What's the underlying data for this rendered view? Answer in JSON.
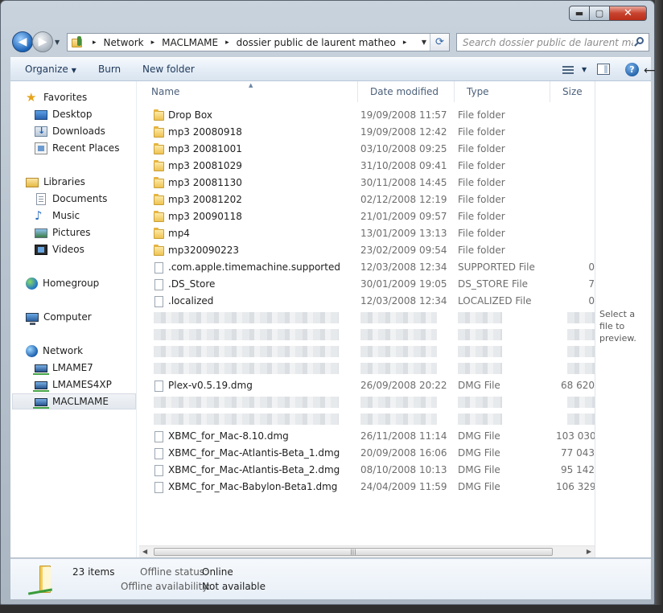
{
  "window": {
    "caption": {
      "minimize": "▬",
      "maximize": "▢",
      "close": "✕"
    }
  },
  "address": {
    "crumbs": [
      "Network",
      "MACLMAME",
      "dossier public de laurent matheo"
    ],
    "separator": "▸"
  },
  "search": {
    "placeholder": "Search dossier public de laurent matheo"
  },
  "toolbar": {
    "organize": "Organize",
    "burn": "Burn",
    "new_folder": "New folder",
    "help": "?"
  },
  "sidebar": {
    "favorites": {
      "label": "Favorites",
      "items": [
        "Desktop",
        "Downloads",
        "Recent Places"
      ]
    },
    "libraries": {
      "label": "Libraries",
      "items": [
        "Documents",
        "Music",
        "Pictures",
        "Videos"
      ]
    },
    "homegroup": {
      "label": "Homegroup"
    },
    "computer": {
      "label": "Computer"
    },
    "network": {
      "label": "Network",
      "items": [
        "LMAME7",
        "LMAMES4XP",
        "MACLMAME"
      ],
      "selected": "MACLMAME"
    }
  },
  "columns": {
    "name": "Name",
    "date": "Date modified",
    "type": "Type",
    "size": "Size"
  },
  "files": [
    {
      "name": "Drop Box",
      "date": "19/09/2008 11:57",
      "type": "File folder",
      "size": "",
      "kind": "folder"
    },
    {
      "name": "mp3 20080918",
      "date": "19/09/2008 12:42",
      "type": "File folder",
      "size": "",
      "kind": "folder"
    },
    {
      "name": "mp3 20081001",
      "date": "03/10/2008 09:25",
      "type": "File folder",
      "size": "",
      "kind": "folder"
    },
    {
      "name": "mp3 20081029",
      "date": "31/10/2008 09:41",
      "type": "File folder",
      "size": "",
      "kind": "folder"
    },
    {
      "name": "mp3 20081130",
      "date": "30/11/2008 14:45",
      "type": "File folder",
      "size": "",
      "kind": "folder"
    },
    {
      "name": "mp3 20081202",
      "date": "02/12/2008 12:19",
      "type": "File folder",
      "size": "",
      "kind": "folder"
    },
    {
      "name": "mp3 20090118",
      "date": "21/01/2009 09:57",
      "type": "File folder",
      "size": "",
      "kind": "folder"
    },
    {
      "name": "mp4",
      "date": "13/01/2009 13:13",
      "type": "File folder",
      "size": "",
      "kind": "folder"
    },
    {
      "name": "mp320090223",
      "date": "23/02/2009 09:54",
      "type": "File folder",
      "size": "",
      "kind": "folder"
    },
    {
      "name": ".com.apple.timemachine.supported",
      "date": "12/03/2008 12:34",
      "type": "SUPPORTED File",
      "size": "0",
      "kind": "file"
    },
    {
      "name": ".DS_Store",
      "date": "30/01/2009 19:05",
      "type": "DS_STORE File",
      "size": "7",
      "kind": "file"
    },
    {
      "name": ".localized",
      "date": "12/03/2008 12:34",
      "type": "LOCALIZED File",
      "size": "0",
      "kind": "file"
    },
    {
      "name": "",
      "date": "",
      "type": "",
      "size": "",
      "kind": "blurred"
    },
    {
      "name": "",
      "date": "",
      "type": "",
      "size": "",
      "kind": "blurred"
    },
    {
      "name": "",
      "date": "",
      "type": "",
      "size": "",
      "kind": "blurred"
    },
    {
      "name": "",
      "date": "",
      "type": "",
      "size": "",
      "kind": "blurred"
    },
    {
      "name": "Plex-v0.5.19.dmg",
      "date": "26/09/2008 20:22",
      "type": "DMG File",
      "size": "68 620",
      "kind": "file"
    },
    {
      "name": "",
      "date": "",
      "type": "",
      "size": "",
      "kind": "blurred"
    },
    {
      "name": "",
      "date": "",
      "type": "",
      "size": "",
      "kind": "blurred"
    },
    {
      "name": "XBMC_for_Mac-8.10.dmg",
      "date": "26/11/2008 11:14",
      "type": "DMG File",
      "size": "103 030",
      "kind": "file"
    },
    {
      "name": "XBMC_for_Mac-Atlantis-Beta_1.dmg",
      "date": "20/09/2008 16:06",
      "type": "DMG File",
      "size": "77 043",
      "kind": "file"
    },
    {
      "name": "XBMC_for_Mac-Atlantis-Beta_2.dmg",
      "date": "08/10/2008 10:13",
      "type": "DMG File",
      "size": "95 142",
      "kind": "file"
    },
    {
      "name": "XBMC_for_Mac-Babylon-Beta1.dmg",
      "date": "24/04/2009 11:59",
      "type": "DMG File",
      "size": "106 329",
      "kind": "file"
    }
  ],
  "preview": {
    "text": "Select a file to preview."
  },
  "details": {
    "count": "23 items",
    "offline_status_label": "Offline status:",
    "offline_status_value": "Online",
    "offline_availability_label": "Offline availability:",
    "offline_availability_value": "Not available"
  }
}
